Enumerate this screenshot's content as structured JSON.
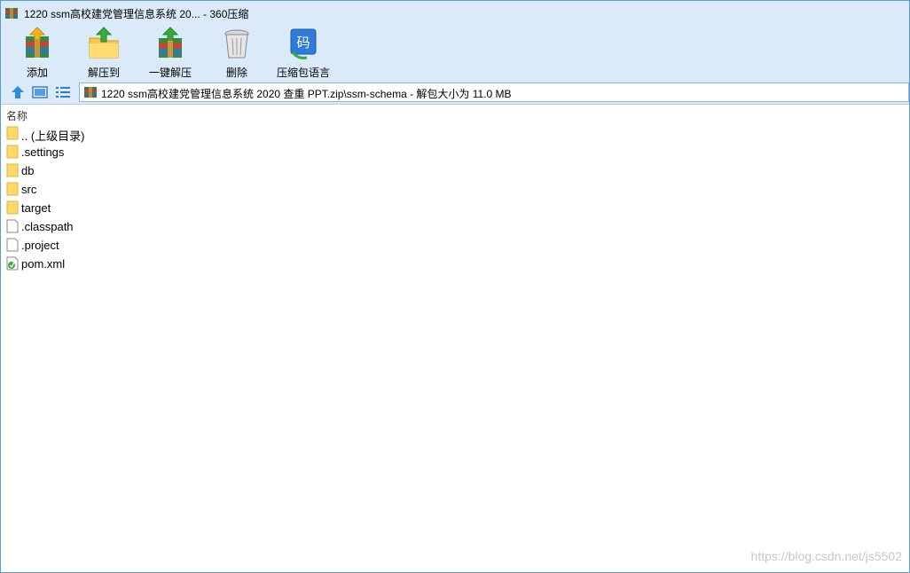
{
  "window": {
    "title": "1220 ssm高校建党管理信息系统 20... - 360压缩"
  },
  "toolbar": {
    "add": "添加",
    "extract_to": "解压到",
    "one_click_extract": "一键解压",
    "delete": "删除",
    "encoding": "压缩包语言"
  },
  "address": {
    "path": "1220 ssm高校建党管理信息系统 2020 查重 PPT.zip\\ssm-schema - 解包大小为 11.0 MB"
  },
  "list": {
    "column_name": "名称",
    "items": [
      {
        "name": ".. (上级目录)",
        "type": "folder"
      },
      {
        "name": ".settings",
        "type": "folder"
      },
      {
        "name": "db",
        "type": "folder"
      },
      {
        "name": "src",
        "type": "folder"
      },
      {
        "name": "target",
        "type": "folder"
      },
      {
        "name": ".classpath",
        "type": "file"
      },
      {
        "name": ".project",
        "type": "file"
      },
      {
        "name": "pom.xml",
        "type": "xml"
      }
    ]
  },
  "watermark": "https://blog.csdn.net/js5502",
  "colors": {
    "chrome": "#dbeaf9",
    "accent": "#2f7bd9",
    "folder": "#ffd96a"
  }
}
